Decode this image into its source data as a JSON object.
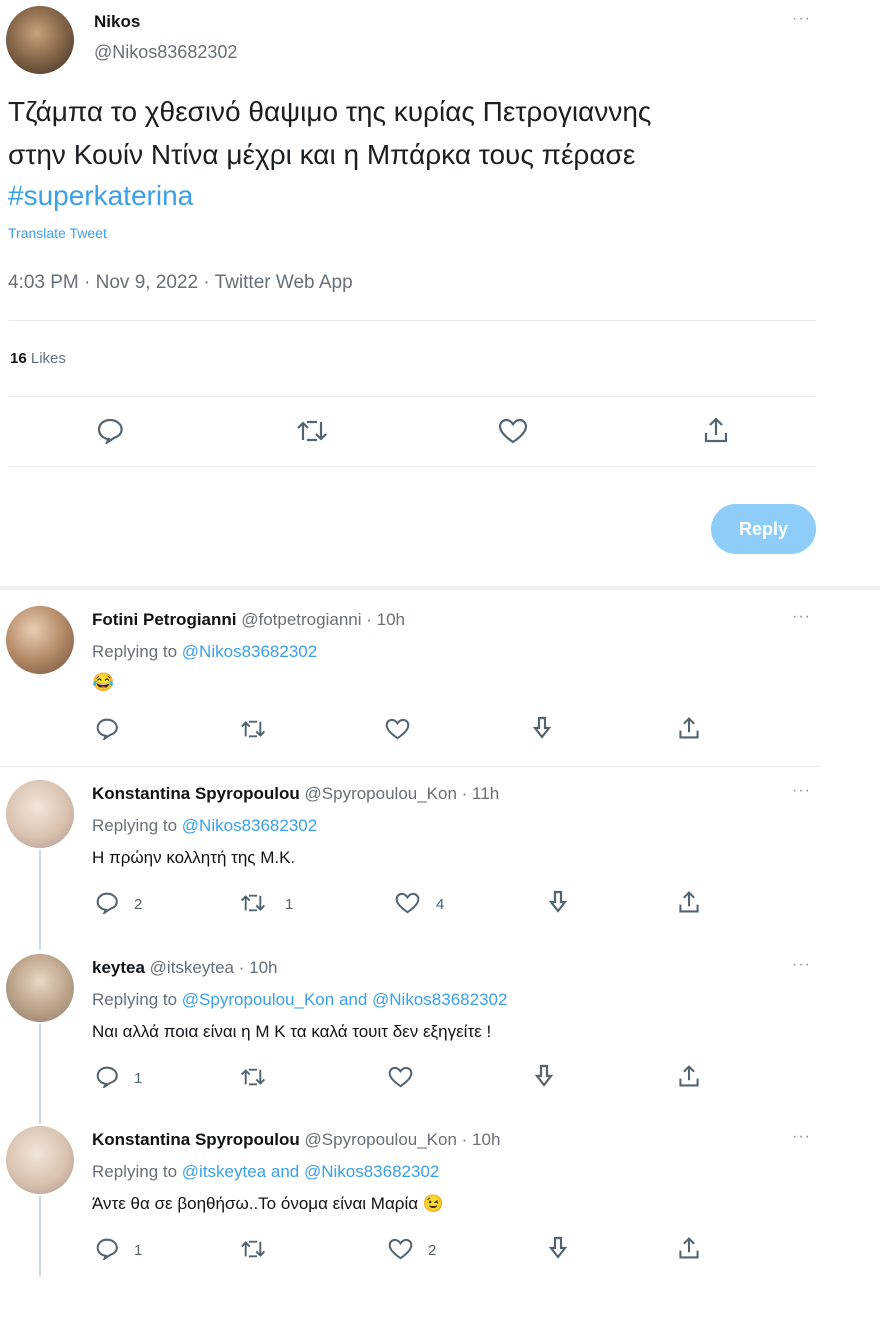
{
  "main_tweet": {
    "author_name": "Nikos",
    "handle": "@Nikos83682302",
    "text_line1": "Τζάμπα το  χθεσινό θαψιμο της κυρίας Πετρογιαννης",
    "text_line2": "στην Κουίν Ντίνα μέχρι και η Μπάρκα τους πέρασε",
    "hashtag": "#superkaterina",
    "translate": "Translate Tweet",
    "meta": "4:03 PM · Nov 9, 2022 · Twitter Web App",
    "likes_count": "16",
    "likes_label": "Likes",
    "icons": [
      "reply-icon",
      "retweet-icon",
      "like-icon",
      "share-icon"
    ]
  },
  "compose": {
    "reply_button": "Reply"
  },
  "replies": [
    {
      "name": "Fotini Petrogianni",
      "handle_time": "@fotpetrogianni · 10h",
      "replying_prefix": "Replying to",
      "replying_to": "@Nikos83682302",
      "text": "😂",
      "counts": {
        "reply": "",
        "retweet": "",
        "like": ""
      }
    },
    {
      "name": "Konstantina Spyropoulou",
      "handle_time": "@Spyropoulou_Kon · 11h",
      "replying_prefix": "Replying to",
      "replying_to": "@Nikos83682302",
      "text": "Η πρώην κολλητή της Μ.Κ.",
      "counts": {
        "reply": "2",
        "retweet": "1",
        "like": "4"
      }
    },
    {
      "name": "keytea",
      "handle_time": "@itskeytea · 10h",
      "replying_prefix": "Replying to",
      "replying_to": "@Spyropoulou_Kon and @Nikos83682302",
      "text": "Ναι αλλά ποια είναι η Μ Κ τα καλά τουιτ δεν εξηγείτε !",
      "counts": {
        "reply": "1",
        "retweet": "",
        "like": ""
      }
    },
    {
      "name": "Konstantina Spyropoulou",
      "handle_time": "@Spyropoulou_Kon · 10h",
      "replying_prefix": "Replying to",
      "replying_to": "@itskeytea and @Nikos83682302",
      "text": "Άντε θα σε βοηθήσω..Το όνομα είναι Μαρία 😉",
      "counts": {
        "reply": "1",
        "retweet": "",
        "like": "2"
      }
    }
  ],
  "more_label": "···",
  "colors": {
    "link": "#3aa0e8",
    "reply_button": "#8ecdf8",
    "divider": "#e6ecf0"
  }
}
